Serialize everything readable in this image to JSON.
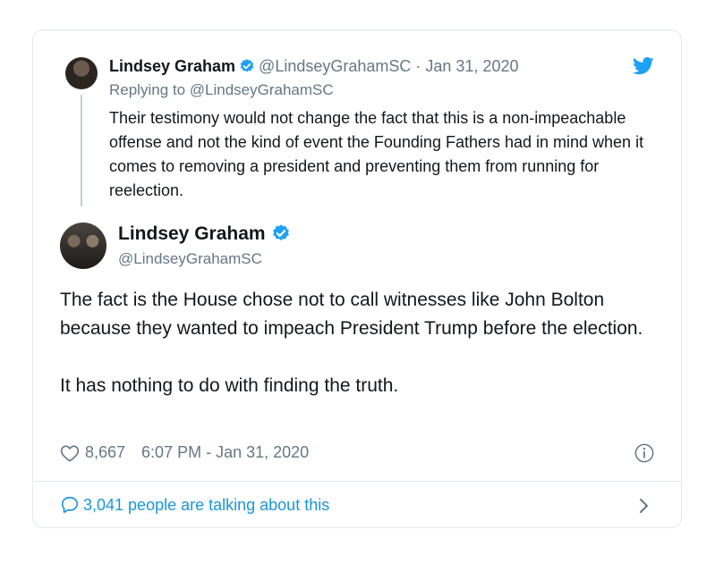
{
  "reply": {
    "name": "Lindsey Graham",
    "handle_date": "@LindseyGrahamSC · Jan 31, 2020",
    "replying_to": "Replying to @LindseyGrahamSC",
    "text": "Their testimony would not change the fact that this is a non-impeachable offense and not the kind of event the Founding Fathers had in mind when it comes to removing a president and preventing them from running for reelection."
  },
  "tweet": {
    "name": "Lindsey Graham",
    "handle": "@LindseyGrahamSC",
    "paragraph1": "The fact is the House chose not to call witnesses like John Bolton because they wanted to impeach President Trump before the election.",
    "paragraph2": "It has nothing to do with finding the truth.",
    "likes": "8,667",
    "timestamp": "6:07 PM - Jan 31, 2020"
  },
  "footer": {
    "talking": "3,041 people are talking about this"
  },
  "icons": {
    "verified": "verified-badge-icon",
    "twitter": "twitter-bird-icon",
    "heart": "heart-icon",
    "info": "info-icon",
    "reply_bubble": "speech-bubble-icon",
    "chevron": "chevron-right-icon"
  },
  "colors": {
    "accent": "#1da1f2",
    "link": "#1b95e0",
    "muted": "#657786",
    "text": "#14171a",
    "border": "#e1e8ed"
  }
}
